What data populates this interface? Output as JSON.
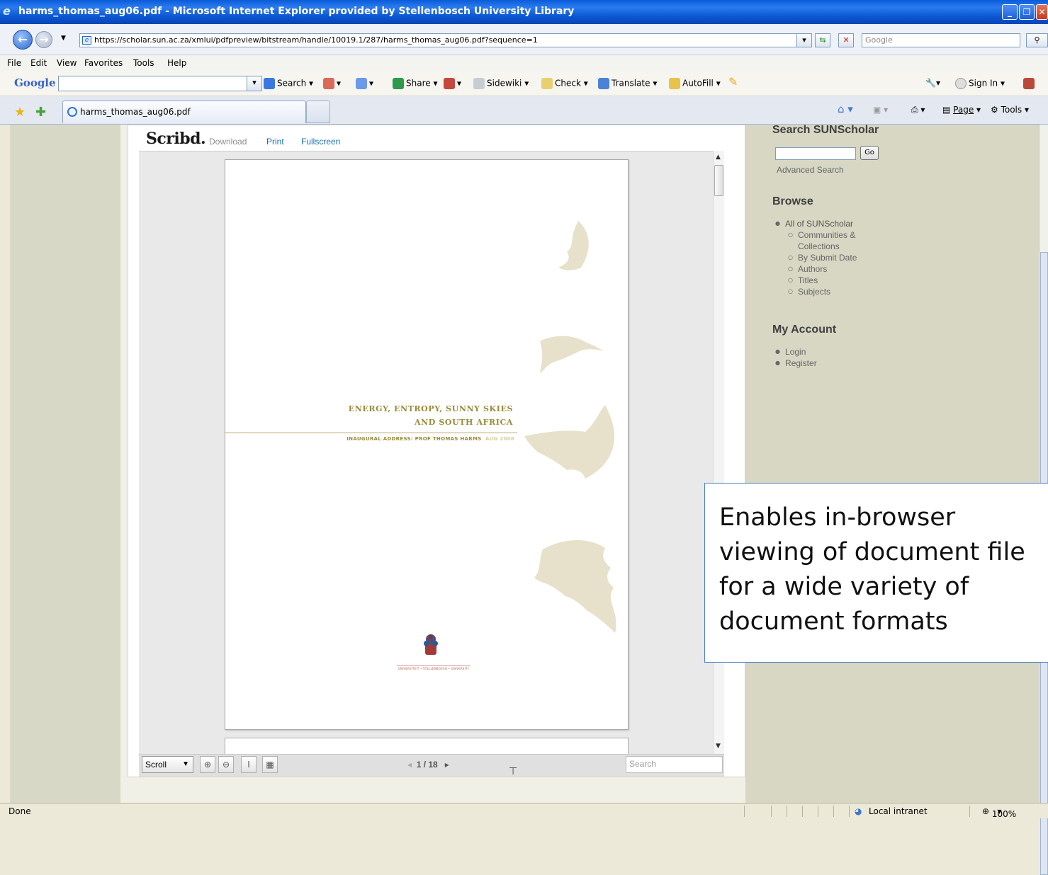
{
  "window": {
    "title": "harms_thomas_aug06.pdf - Microsoft Internet Explorer provided by Stellenbosch University Library"
  },
  "address": {
    "url": "https://scholar.sun.ac.za/xmlui/pdfpreview/bitstream/handle/10019.1/287/harms_thomas_aug06.pdf?sequence=1",
    "search_placeholder": "Google"
  },
  "menu": {
    "items": [
      "File",
      "Edit",
      "View",
      "Favorites",
      "Tools",
      "Help"
    ]
  },
  "google_toolbar": {
    "logo": "Google",
    "search": "Search",
    "share": "Share",
    "sidewiki": "Sidewiki",
    "check": "Check",
    "translate": "Translate",
    "autofill": "AutoFill",
    "sign_in": "Sign In"
  },
  "tabs": {
    "active": "harms_thomas_aug06.pdf"
  },
  "commandbar": {
    "page": "Page",
    "tools": "Tools"
  },
  "scribd": {
    "logo": "Scribd.",
    "download": "Download",
    "print": "Print",
    "fullscreen": "Fullscreen",
    "view_mode": "Scroll",
    "page_indicator": "1 / 18",
    "search_placeholder": "Search"
  },
  "document": {
    "title_line1": "ENERGY, ENTROPY, SUNNY SKIES",
    "title_line2": "AND SOUTH AFRICA",
    "subtitle": "INAUGURAL ADDRESS:  PROF THOMAS HARMS",
    "subtitle_date": "AUG 2006",
    "crest_caption": "UNIVERSITEIT • STELLENBOSCH • UNIVERSITY"
  },
  "sidebar": {
    "search_heading": "Search SUNScholar",
    "go": "Go",
    "advanced": "Advanced Search",
    "browse_heading": "Browse",
    "browse_root": "All of SUNScholar",
    "browse_items": [
      "Communities &",
      "Collections",
      "By Submit Date",
      "Authors",
      "Titles",
      "Subjects"
    ],
    "account_heading": "My Account",
    "account_items": [
      "Login",
      "Register"
    ]
  },
  "callout": {
    "lines": [
      "Enables in-browser",
      "viewing of document file",
      "for a wide variety of",
      "document formats"
    ]
  },
  "status": {
    "left": "Done",
    "zone": "Local intranet",
    "zoom": "100%"
  },
  "colors": {
    "titlebar": "#0a55d0",
    "doc_gold": "#9a8a3a",
    "scribd_link": "#1a6fb5",
    "sidebar_bg": "#d7d7c4"
  }
}
